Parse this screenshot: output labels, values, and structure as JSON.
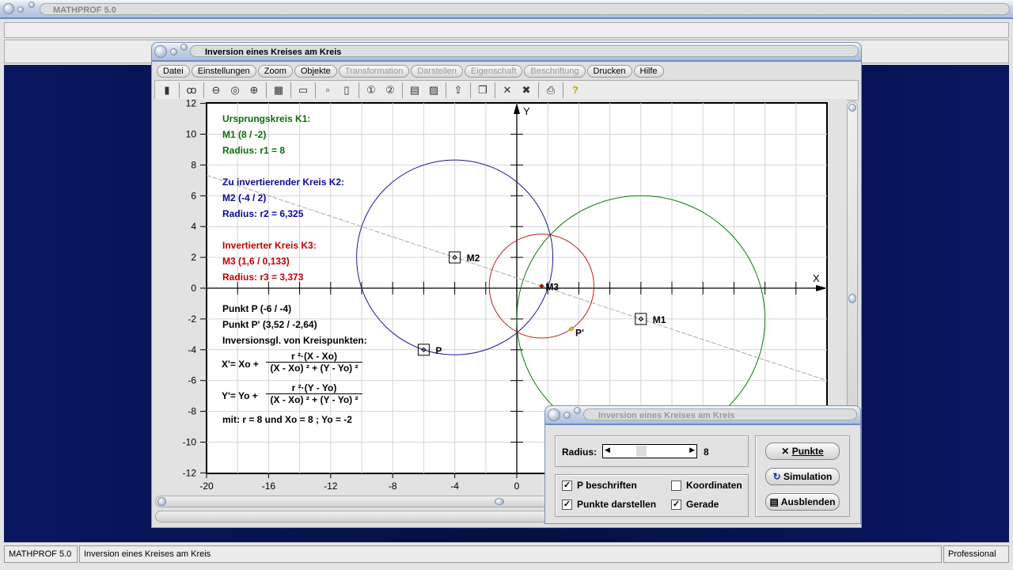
{
  "app": {
    "title": "MATHPROF 5.0"
  },
  "window": {
    "title": "Inversion eines Kreises am Kreis"
  },
  "menu": [
    {
      "label": "Datei",
      "enabled": true
    },
    {
      "label": "Einstellungen",
      "enabled": true
    },
    {
      "label": "Zoom",
      "enabled": true
    },
    {
      "label": "Objekte",
      "enabled": true
    },
    {
      "label": "Transformation",
      "enabled": false
    },
    {
      "label": "Darstellen",
      "enabled": false
    },
    {
      "label": "Eigenschaft",
      "enabled": false
    },
    {
      "label": "Beschriftung",
      "enabled": false
    },
    {
      "label": "Drucken",
      "enabled": true
    },
    {
      "label": "Hilfe",
      "enabled": true
    }
  ],
  "toolbar": [
    "window-icon",
    "glasses-icon",
    "zoom-out-icon",
    "zoom-reset-icon",
    "zoom-in-icon",
    "properties-icon",
    "layout-icon",
    "single-icon",
    "double-icon",
    "circle-1-icon",
    "circle-2-icon",
    "table-icon",
    "document-icon",
    "export-icon",
    "copy-icon",
    "cross-icon",
    "cross-double-icon",
    "print-icon",
    "help-icon"
  ],
  "plot": {
    "x_ticks": [
      -20,
      -16,
      -12,
      -8,
      -4,
      0
    ],
    "y_ticks": [
      12,
      10,
      8,
      6,
      4,
      2,
      0,
      -2,
      -4,
      -6,
      -8,
      -10,
      -12
    ],
    "xlim": [
      -20,
      20
    ],
    "ylim": [
      -12,
      12
    ],
    "x_axis_label": "X",
    "y_axis_label": "Y",
    "circles": [
      {
        "name": "K1",
        "cx": 8,
        "cy": -2,
        "r": 8,
        "color": "#0a7a0a"
      },
      {
        "name": "K2",
        "cx": -4,
        "cy": 2,
        "r": 6.325,
        "color": "#1a1a9a"
      },
      {
        "name": "K3",
        "cx": 1.6,
        "cy": 0.133,
        "r": 3.373,
        "color": "#c81818"
      }
    ],
    "points": [
      {
        "label": "M1",
        "x": 8,
        "y": -2,
        "boxed": true
      },
      {
        "label": "M2",
        "x": -4,
        "y": 2,
        "boxed": true
      },
      {
        "label": "M3",
        "x": 1.6,
        "y": 0.133,
        "boxed": false,
        "color": "#c00000"
      },
      {
        "label": "P",
        "x": -6,
        "y": -4,
        "boxed": true
      },
      {
        "label": "P'",
        "x": 3.52,
        "y": -2.64,
        "boxed": false,
        "color": "#e0c000"
      }
    ]
  },
  "info": {
    "k1_title": "Ursprungskreis K1:",
    "k1_center": "M1 (8 / -2)",
    "k1_radius": "Radius: r1 = 8",
    "k2_title": "Zu invertierender Kreis K2:",
    "k2_center": "M2 (-4 / 2)",
    "k2_radius": "Radius: r2 = 6,325",
    "k3_title": "Invertierter Kreis K3:",
    "k3_center": "M3 (1,6 / 0,133)",
    "k3_radius": "Radius: r3 = 3,373",
    "point_p": "Punkt P (-6 / -4)",
    "point_p2": "Punkt P' (3,52 / -2,64)",
    "eq_title": "Inversionsgl. von Kreispunkten:",
    "x_lhs": "X'= Xo +",
    "x_num": "r ²·(X - Xo)",
    "x_den": "(X - Xo) ² + (Y - Yo) ²",
    "y_lhs": "Y'= Yo +",
    "y_num": "r ²·(Y - Yo)",
    "y_den": "(X - Xo) ² + (Y - Yo) ²",
    "mit": "mit: r = 8 und Xo = 8 ; Yo = -2"
  },
  "dialog": {
    "title": "Inversion eines Kreises am Kreis",
    "radius_label": "Radius:",
    "radius_value": "8",
    "radius_fraction": 0.35,
    "checkboxes": [
      {
        "label": "P beschriften",
        "checked": true
      },
      {
        "label": "Koordinaten",
        "checked": false
      },
      {
        "label": "Punkte darstellen",
        "checked": true
      },
      {
        "label": "Gerade",
        "checked": true
      }
    ],
    "buttons": {
      "punkte": "Punkte",
      "simulation": "Simulation",
      "ausblenden": "Ausblenden"
    }
  },
  "status": {
    "app": "MATHPROF 5.0",
    "doc": "Inversion eines Kreises am Kreis",
    "edition": "Professional"
  }
}
